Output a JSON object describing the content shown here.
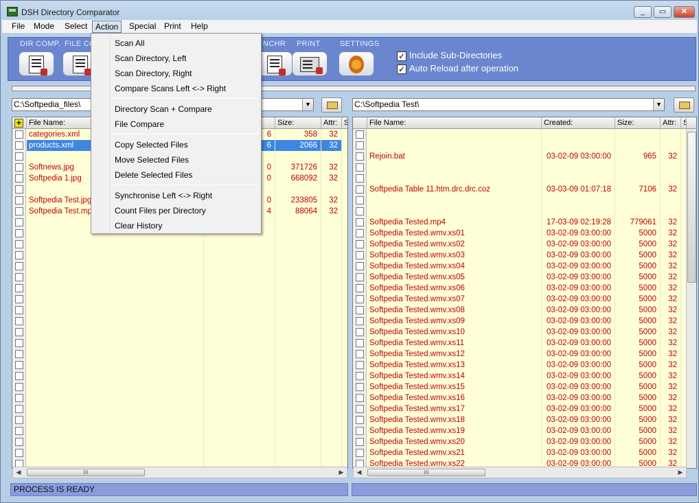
{
  "window": {
    "title": "DSH Directory Comparator"
  },
  "menubar": [
    "File",
    "Mode",
    "Select",
    "Action",
    "Special",
    "Print",
    "Help"
  ],
  "toolbar": {
    "labels": [
      "DIR COMP.",
      "FILE CO",
      "NCHR",
      "PRINT",
      "SETTINGS"
    ],
    "options": [
      {
        "label": "Include Sub-Directories",
        "checked": true
      },
      {
        "label": "Auto Reload after operation",
        "checked": true
      }
    ]
  },
  "action_menu": {
    "items": [
      "Scan All",
      "Scan Directory, Left",
      "Scan Directory, Right",
      "Compare Scans Left <-> Right",
      "Directory Scan + Compare",
      "File Compare",
      "Copy Selected Files",
      "Move Selected Files",
      "Delete Selected Files",
      "Synchronise Left <-> Right",
      "Count Files per Directory",
      "Clear History"
    ]
  },
  "left": {
    "path": "C:\\Softpedia_files\\",
    "columns": [
      "File Name:",
      "Size:",
      "Attr:",
      "S"
    ],
    "rows": [
      {
        "name": "categories.xml",
        "date_frag": "6",
        "size": "358",
        "attr": "32"
      },
      {
        "name": "products.xml",
        "date_frag": "6",
        "size": "2066",
        "attr": "32",
        "selected": true
      },
      {
        "name": "",
        "date_frag": "",
        "size": "",
        "attr": ""
      },
      {
        "name": "Softnews.jpg",
        "date_frag": "0",
        "size": "371726",
        "attr": "32"
      },
      {
        "name": "Softpedia 1.jpg",
        "date_frag": "0",
        "size": "668092",
        "attr": "32"
      },
      {
        "name": "",
        "date_frag": "",
        "size": "",
        "attr": ""
      },
      {
        "name": "Softpedia Test.jpg",
        "date_frag": "0",
        "size": "233805",
        "attr": "32"
      },
      {
        "name": "Softpedia Test.mpg",
        "date_frag": "4",
        "size": "88064",
        "attr": "32"
      }
    ],
    "status": "PROCESS IS READY"
  },
  "right": {
    "path": "C:\\Softpedia Test\\",
    "columns": [
      "File Name:",
      "Created:",
      "Size:",
      "Attr:",
      "S"
    ],
    "rows": [
      {
        "name": "",
        "created": "",
        "size": "",
        "attr": ""
      },
      {
        "name": "",
        "created": "",
        "size": "",
        "attr": ""
      },
      {
        "name": "Rejoin.bat",
        "created": "03-02-09 03:00:00",
        "size": "965",
        "attr": "32"
      },
      {
        "name": "",
        "created": "",
        "size": "",
        "attr": ""
      },
      {
        "name": "",
        "created": "",
        "size": "",
        "attr": ""
      },
      {
        "name": "Softpedia Table 11.htm.drc.drc.coz",
        "created": "03-03-09 01:07:18",
        "size": "7106",
        "attr": "32"
      },
      {
        "name": "",
        "created": "",
        "size": "",
        "attr": ""
      },
      {
        "name": "",
        "created": "",
        "size": "",
        "attr": ""
      },
      {
        "name": "Softpedia Tested.mp4",
        "created": "17-03-09 02:19:28",
        "size": "779061",
        "attr": "32"
      },
      {
        "name": "Softpedia Tested.wmv.xs01",
        "created": "03-02-09 03:00:00",
        "size": "5000",
        "attr": "32"
      },
      {
        "name": "Softpedia Tested.wmv.xs02",
        "created": "03-02-09 03:00:00",
        "size": "5000",
        "attr": "32"
      },
      {
        "name": "Softpedia Tested.wmv.xs03",
        "created": "03-02-09 03:00:00",
        "size": "5000",
        "attr": "32"
      },
      {
        "name": "Softpedia Tested.wmv.xs04",
        "created": "03-02-09 03:00:00",
        "size": "5000",
        "attr": "32"
      },
      {
        "name": "Softpedia Tested.wmv.xs05",
        "created": "03-02-09 03:00:00",
        "size": "5000",
        "attr": "32"
      },
      {
        "name": "Softpedia Tested.wmv.xs06",
        "created": "03-02-09 03:00:00",
        "size": "5000",
        "attr": "32"
      },
      {
        "name": "Softpedia Tested.wmv.xs07",
        "created": "03-02-09 03:00:00",
        "size": "5000",
        "attr": "32"
      },
      {
        "name": "Softpedia Tested.wmv.xs08",
        "created": "03-02-09 03:00:00",
        "size": "5000",
        "attr": "32"
      },
      {
        "name": "Softpedia Tested.wmv.xs09",
        "created": "03-02-09 03:00:00",
        "size": "5000",
        "attr": "32"
      },
      {
        "name": "Softpedia Tested.wmv.xs10",
        "created": "03-02-09 03:00:00",
        "size": "5000",
        "attr": "32"
      },
      {
        "name": "Softpedia Tested.wmv.xs11",
        "created": "03-02-09 03:00:00",
        "size": "5000",
        "attr": "32"
      },
      {
        "name": "Softpedia Tested.wmv.xs12",
        "created": "03-02-09 03:00:00",
        "size": "5000",
        "attr": "32"
      },
      {
        "name": "Softpedia Tested.wmv.xs13",
        "created": "03-02-09 03:00:00",
        "size": "5000",
        "attr": "32"
      },
      {
        "name": "Softpedia Tested.wmv.xs14",
        "created": "03-02-09 03:00:00",
        "size": "5000",
        "attr": "32"
      },
      {
        "name": "Softpedia Tested.wmv.xs15",
        "created": "03-02-09 03:00:00",
        "size": "5000",
        "attr": "32"
      },
      {
        "name": "Softpedia Tested.wmv.xs16",
        "created": "03-02-09 03:00:00",
        "size": "5000",
        "attr": "32"
      },
      {
        "name": "Softpedia Tested.wmv.xs17",
        "created": "03-02-09 03:00:00",
        "size": "5000",
        "attr": "32"
      },
      {
        "name": "Softpedia Tested.wmv.xs18",
        "created": "03-02-09 03:00:00",
        "size": "5000",
        "attr": "32"
      },
      {
        "name": "Softpedia Tested.wmv.xs19",
        "created": "03-02-09 03:00:00",
        "size": "5000",
        "attr": "32"
      },
      {
        "name": "Softpedia Tested.wmv.xs20",
        "created": "03-02-09 03:00:00",
        "size": "5000",
        "attr": "32"
      },
      {
        "name": "Softpedia Tested.wmv.xs21",
        "created": "03-02-09 03:00:00",
        "size": "5000",
        "attr": "32"
      },
      {
        "name": "Softpedia Tested.wmv.xs22",
        "created": "03-02-09 03:00:00",
        "size": "5000",
        "attr": "32"
      }
    ]
  },
  "scroll_glyph": "III",
  "colors": {
    "toolbar": "#6a86cf",
    "grid_bg": "#ffffd7",
    "file_text": "#c00000",
    "selection": "#3d86e2",
    "status_bar": "#8b9bd9"
  }
}
